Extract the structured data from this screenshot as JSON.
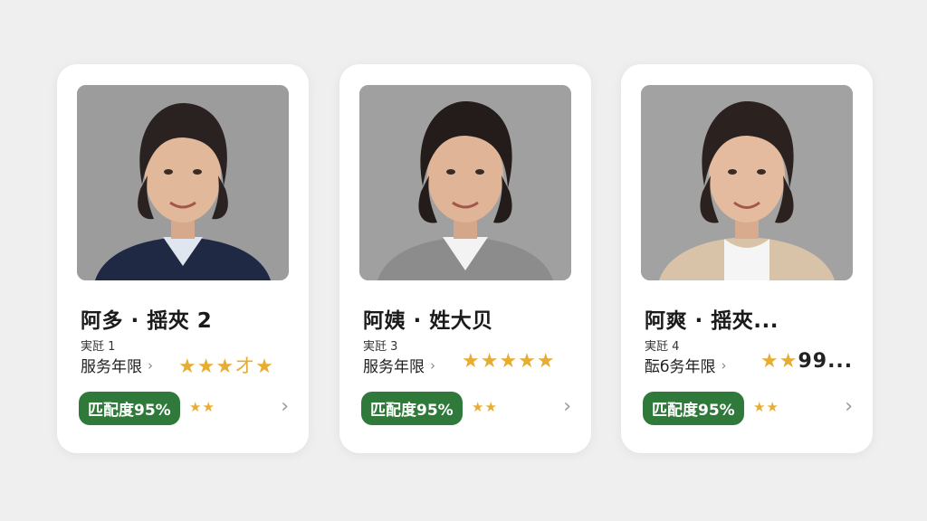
{
  "cards": [
    {
      "name": "阿多 · 揺夾 2",
      "experience": "実瓩 1",
      "service_label": "服务年限",
      "service_chevron": "›",
      "stars": "★★★",
      "stars_tail": "オ★",
      "match": "匹配度95%",
      "small_stars": "★★",
      "chevron": "›",
      "jacket_color": "#1f2944"
    },
    {
      "name": "阿姨 · 姓大贝",
      "experience": "実瓩 3",
      "service_label": "服务年限",
      "service_chevron": "›",
      "stars": "★★★★★",
      "stars_tail": "",
      "match": "匹配度95%",
      "small_stars": "★★",
      "chevron": "›",
      "jacket_color": "#8c8c8c"
    },
    {
      "name": "阿爽 · 揺夾...",
      "experience": "実瓩 4",
      "service_label": "酝б务年限",
      "service_chevron": "›",
      "stars": "★★",
      "stars_tail": "99...",
      "match": "匹配度95%",
      "small_stars": "★★",
      "chevron": "›",
      "jacket_color": "#d9c3a8"
    }
  ],
  "colors": {
    "accent_green": "#2f7a3b",
    "star_gold": "#e7ad33"
  }
}
